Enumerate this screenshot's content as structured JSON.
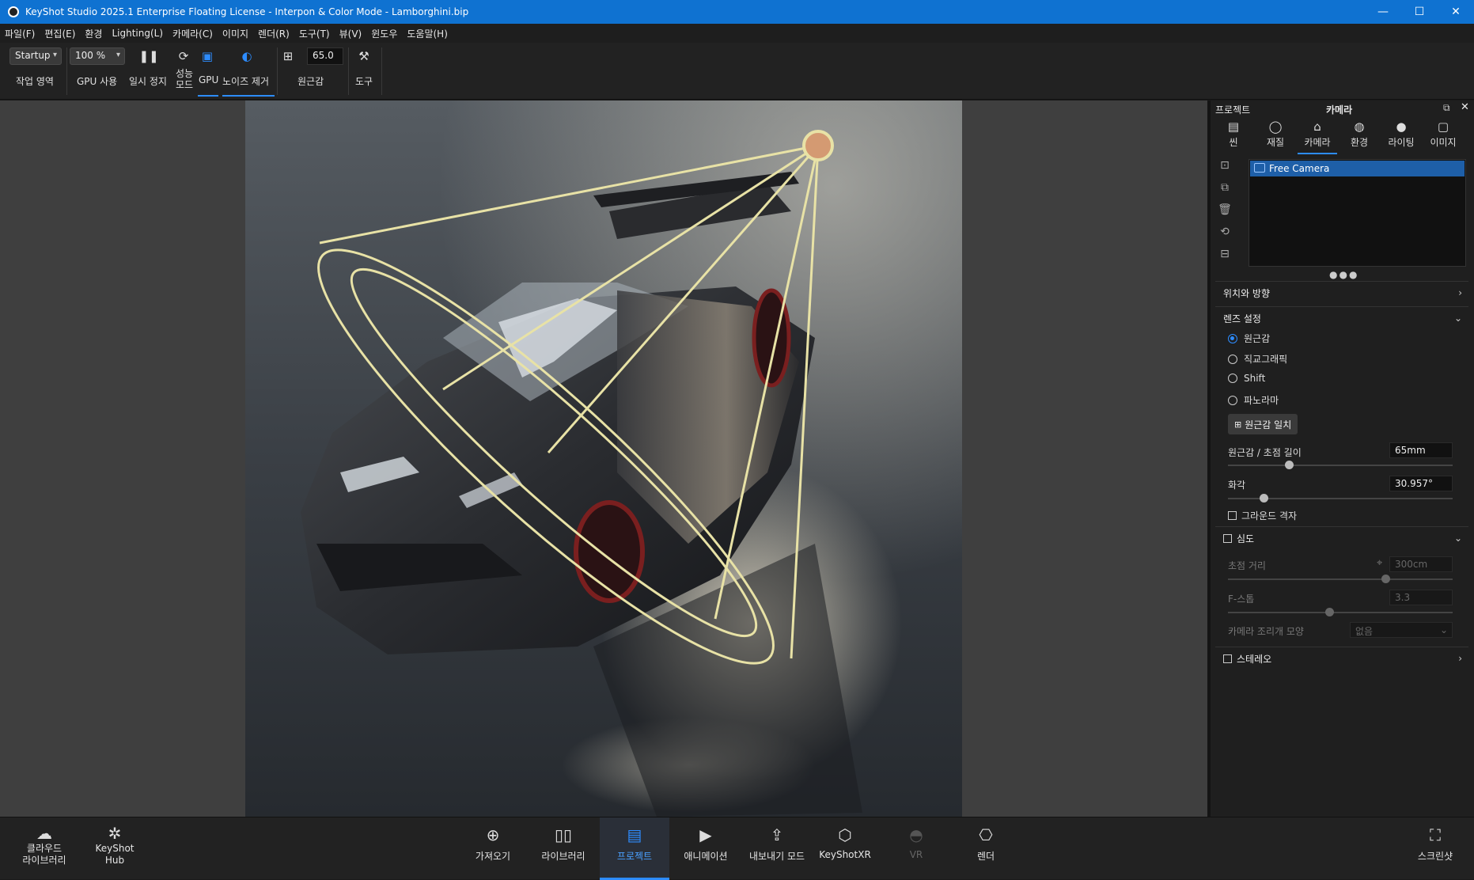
{
  "window": {
    "title": "KeyShot Studio 2025.1 Enterprise Floating License  - Interpon & Color Mode - Lamborghini.bip",
    "minimize": "—",
    "maximize": "☐",
    "close": "✕"
  },
  "menu": [
    "파일(F)",
    "편집(E)",
    "환경",
    "Lighting(L)",
    "카메라(C)",
    "이미지",
    "렌더(R)",
    "도구(T)",
    "뷰(V)",
    "윈도우",
    "도움말(H)"
  ],
  "toolbar": {
    "workspace_value": "Startup",
    "workspace_label": "작업 영역",
    "zoom_value": "100 %",
    "gpu_use_label": "GPU 사용",
    "pause_label": "일시 정지",
    "perf_mode_label": "성능\n모드",
    "perf_mode_line1": "성능",
    "perf_mode_line2": "모드",
    "gpu_label": "GPU",
    "denoise_label": "노이즈 제거",
    "perspective_value": "65.0",
    "perspective_label": "원근감",
    "tools_label": "도구"
  },
  "panel": {
    "left_title": "프로젝트",
    "center_title": "카메라",
    "tabs": [
      {
        "label": "씬",
        "icon": "scene-icon"
      },
      {
        "label": "재질",
        "icon": "material-icon"
      },
      {
        "label": "카메라",
        "icon": "camera-icon"
      },
      {
        "label": "환경",
        "icon": "environment-icon"
      },
      {
        "label": "라이팅",
        "icon": "lighting-icon"
      },
      {
        "label": "이미지",
        "icon": "image-icon"
      }
    ],
    "camera_list": [
      "Free Camera"
    ],
    "dots": "●●●",
    "position_section": "위치와 방향",
    "lens_section": "렌즈 설정",
    "lens_options": [
      {
        "label": "원근감",
        "selected": true
      },
      {
        "label": "직교그래픽",
        "selected": false
      },
      {
        "label": "Shift",
        "selected": false
      },
      {
        "label": "파노라마",
        "selected": false
      }
    ],
    "match_perspective_button": "원근감 일치",
    "focal_label": "원근감 / 초점 길이",
    "focal_value": "65mm",
    "focal_slider": 0.27,
    "fov_label": "화각",
    "fov_value": "30.957°",
    "fov_slider": 0.16,
    "ground_grid_label": "그라운드 격자",
    "dof_section": "심도",
    "focus_distance_label": "초점 거리",
    "focus_distance_value": "300cm",
    "focus_distance_slider": 0.7,
    "fstop_label": "F-스톱",
    "fstop_value": "3.3",
    "fstop_slider": 0.45,
    "aperture_label": "카메라 조리개 모양",
    "aperture_value": "없음",
    "stereo_section": "스테레오"
  },
  "bottom": {
    "cloud_library_line1": "클라우드",
    "cloud_library_line2": "라이브러리",
    "hub_line1": "KeyShot",
    "hub_line2": "Hub",
    "import": "가져오기",
    "library": "라이브러리",
    "project": "프로젝트",
    "animation": "애니메이션",
    "export_mode": "내보내기 모드",
    "keyshotxr": "KeyShotXR",
    "vr": "VR",
    "render": "렌더",
    "screenshot": "스크린샷"
  },
  "colors": {
    "title_bar": "#0f72d1",
    "accent": "#2d8cff",
    "light_gizmo": "#e8e2a6",
    "light_sun": "#d49a72"
  }
}
